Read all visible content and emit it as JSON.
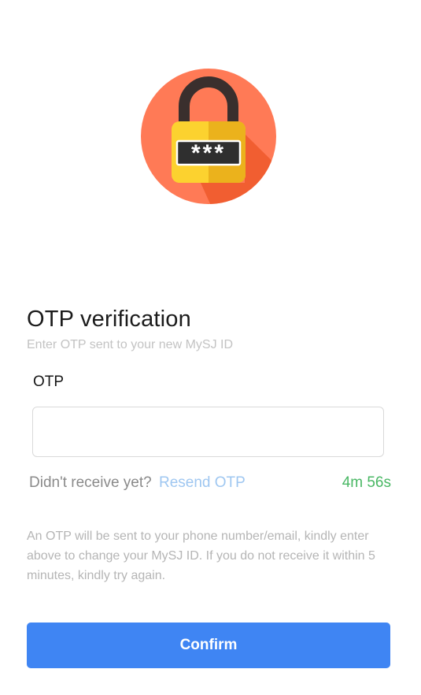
{
  "icon": {
    "name": "otp-lock-icon",
    "masked_code": "***",
    "circle_color": "#ff7a56",
    "shadow_color": "#f05b2e",
    "shackle_color": "#3a2f2d",
    "lock_color": "#fcd22f",
    "lock_shade_color": "#ebb21c"
  },
  "header": {
    "title": "OTP verification",
    "subtitle": "Enter OTP sent to your new MySJ ID"
  },
  "form": {
    "otp_label": "OTP",
    "otp_value": "",
    "otp_placeholder": ""
  },
  "resend": {
    "question": "Didn't receive yet?",
    "link": "Resend OTP",
    "timer": "4m 56s",
    "timer_color": "#49b764",
    "link_color": "#9fc7f1"
  },
  "info_text": "An OTP will be sent to your phone number/email, kindly enter above to change your MySJ ID. If you do not receive it within 5 minutes, kindly try again.",
  "actions": {
    "confirm_label": "Confirm",
    "accent_color": "#3f85f3"
  }
}
